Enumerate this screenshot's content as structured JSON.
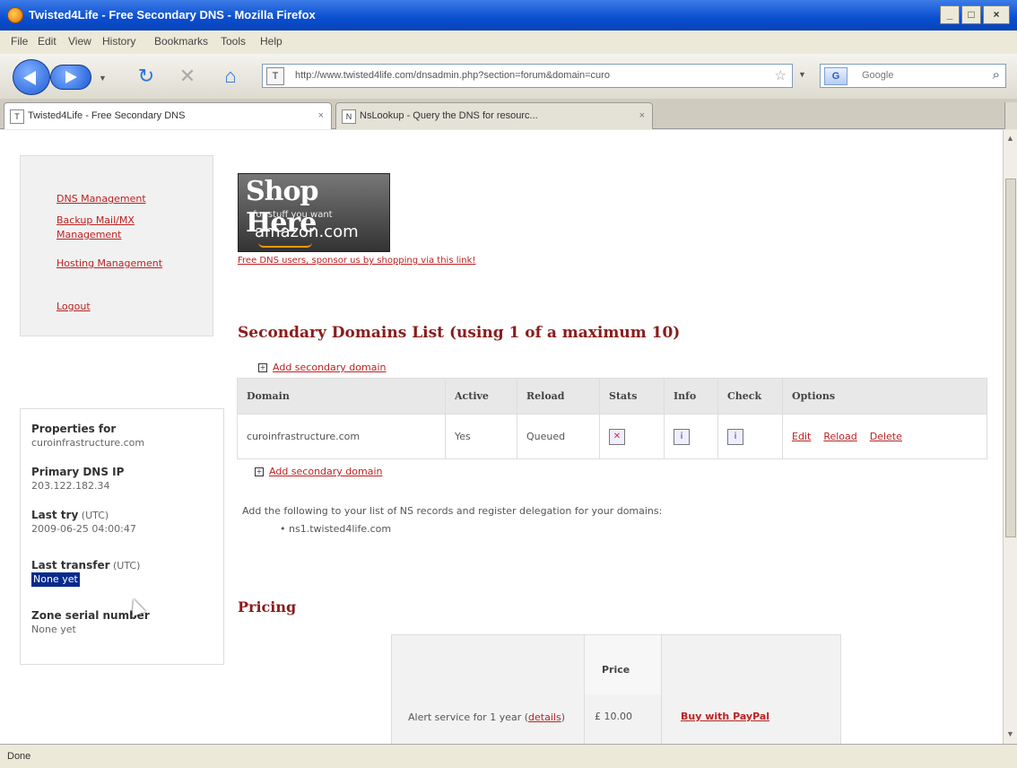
{
  "window": {
    "title": "Twisted4Life - Free Secondary DNS - Mozilla Firefox",
    "min": "_",
    "max": "□",
    "close": "×"
  },
  "menu": [
    "File",
    "Edit",
    "View",
    "History",
    "Bookmarks",
    "Tools",
    "Help"
  ],
  "nav": {
    "url": "http://www.twisted4life.com/dnsadmin.php?section=forum&domain=curo",
    "search_placeholder": "Google",
    "search_engine": "G"
  },
  "tabs": [
    {
      "label": "Twisted4Life - Free Secondary DNS",
      "active": true
    },
    {
      "label": "NsLookup - Query the DNS for resourc...",
      "active": false
    }
  ],
  "sidebar": {
    "items": [
      "DNS Management",
      "Backup Mail/MX Management",
      "Hosting Management",
      "Logout"
    ]
  },
  "banner": {
    "line1": "Shop Here",
    "line2": "for stuff you want",
    "line3": "amazon.com"
  },
  "promo_link": "Free DNS users, sponsor us by shopping via this link!",
  "properties": {
    "heading": "Properties for",
    "domain": "curoinfrastructure.com",
    "primary_ip_label": "Primary DNS IP",
    "primary_ip": "203.122.182.34",
    "last_try_label": "Last try",
    "last_try_unit": "(UTC)",
    "last_try": "2009-06-25 04:00:47",
    "last_transfer_label": "Last transfer",
    "last_transfer_unit": "(UTC)",
    "last_transfer": "None yet",
    "serial_label": "Zone serial number",
    "serial": "None yet"
  },
  "domains": {
    "title": "Secondary Domains List (using 1 of a maximum 10)",
    "add_label": "Add secondary domain",
    "columns": [
      "Domain",
      "Active",
      "Reload",
      "Stats",
      "Info",
      "Check",
      "Options"
    ],
    "rows": [
      {
        "domain": "curoinfrastructure.com",
        "active": "Yes",
        "reload": "Queued",
        "edit": "Edit",
        "reload_link": "Reload",
        "delete": "Delete"
      }
    ]
  },
  "ns_note": "Add the following to your list of NS records and register delegation for your domains:",
  "ns_records": [
    "ns1.twisted4life.com"
  ],
  "pricing": {
    "title": "Pricing",
    "price_header": "Price",
    "item": "Alert service for 1 year",
    "details": "details",
    "price": "£ 10.00",
    "buy": "Buy with PayPal"
  },
  "status": "Done"
}
